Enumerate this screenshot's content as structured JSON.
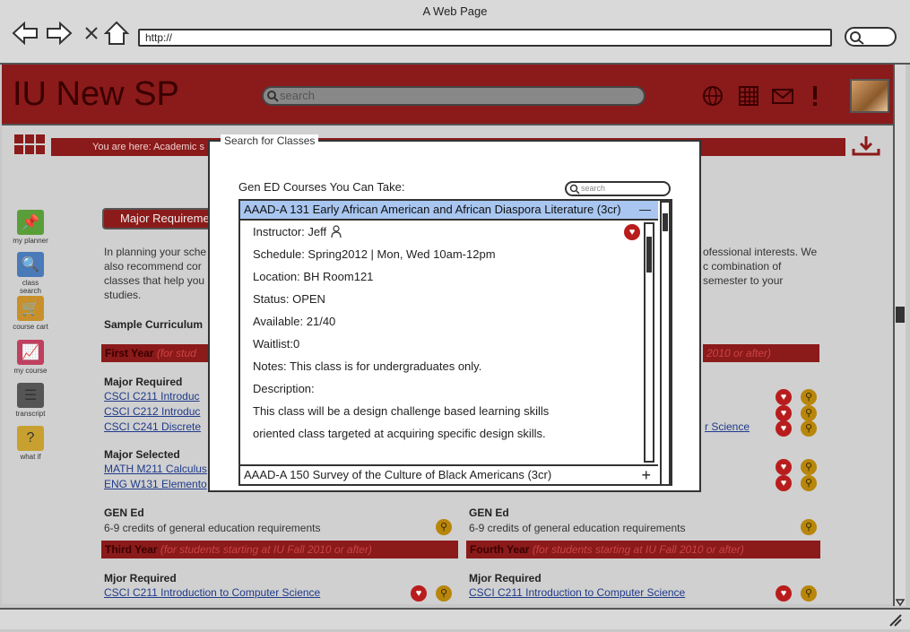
{
  "browser": {
    "window_title": "A Web Page",
    "url": "http://"
  },
  "header": {
    "site_title": "IU New SP",
    "search_placeholder": "search"
  },
  "breadcrumb": "You are here: Academic s",
  "sidebar": [
    {
      "label": "my planner",
      "icon": "pin-icon",
      "color": "#5a9e3a"
    },
    {
      "label": "class search",
      "icon": "search-icon",
      "color": "#4a7ab8"
    },
    {
      "label": "course cart",
      "icon": "cart-icon",
      "color": "#c8902a"
    },
    {
      "label": "my course",
      "icon": "chart-icon",
      "color": "#c04060"
    },
    {
      "label": "transcript",
      "icon": "list-icon",
      "color": "#555555"
    },
    {
      "label": "what if",
      "icon": "question-icon",
      "color": "#c8a030"
    }
  ],
  "main": {
    "major_button": "Major Requireme",
    "intro_left": [
      "In planning your sche",
      "also recommend cor",
      "classes that help you",
      "studies."
    ],
    "intro_right": [
      "ofessional interests. We",
      "c combination of",
      "semester to your"
    ],
    "sample_curriculum": "Sample Curriculum",
    "first_year": {
      "label": "First Year",
      "note": "(for stud"
    },
    "first_year_right_note": "2010 or after)",
    "major_required": "Major Required",
    "major_required_links": [
      "CSCI C211 Introduc",
      "CSCI C212 Introduc",
      "CSCI C241 Discrete"
    ],
    "right_link": "r Science",
    "major_selected": "Major Selected",
    "major_selected_links": [
      "MATH M211 Calculus",
      "ENG W131 Elemento"
    ],
    "gen_ed_left": {
      "title": "GEN Ed",
      "text": "6-9 credits of general education requirements"
    },
    "gen_ed_right": {
      "title": "GEN Ed",
      "text": "6-9 credits of general education requirements"
    },
    "third_year": {
      "label": "Third Year",
      "note": "(for students starting at IU Fall 2010 or after)"
    },
    "fourth_year": {
      "label": "Fourth Year",
      "note": "(for students starting at IU Fall 2010 or after)"
    },
    "mjor_left": {
      "title": "Mjor Required",
      "link": "CSCI C211 Introduction to Computer Science"
    },
    "mjor_right": {
      "title": "Mjor Required",
      "link": "CSCI C211 Introduction to Computer Science"
    }
  },
  "modal": {
    "title": "Search for Classes",
    "label": "Gen ED Courses You Can Take:",
    "search_placeholder": "search",
    "course1": {
      "title": "AAAD-A 131 Early African American and African Diaspora Literature (3cr)",
      "collapse_symbol": "—",
      "instructor": "Instructor: Jeff",
      "schedule": "Schedule: Spring2012 | Mon, Wed 10am-12pm",
      "location": "Location: BH Room121",
      "status": "Status: OPEN",
      "available": "Available: 21/40",
      "waitlist": "Waitlist:0",
      "notes": "Notes: This class is for undergraduates only.",
      "description_label": "Description:",
      "description_1": "This class will be a design challenge based learning skills",
      "description_2": "oriented class targeted at acquiring specific design skills."
    },
    "course2": {
      "title": "AAAD-A 150 Survey of the Culture of Black Americans (3cr)",
      "expand_symbol": "+"
    }
  },
  "colors": {
    "brand": "#8b1a1a",
    "accent_row": "#a8c6f0"
  }
}
